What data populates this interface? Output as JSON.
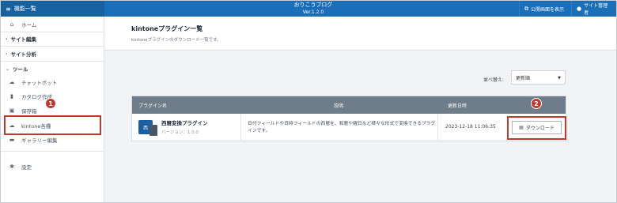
{
  "header": {
    "menu_label": "機能一覧",
    "brand": "おりこうブログ",
    "version": "Ver.1.2.0",
    "public_view_btn": "公開画面を表示",
    "site_admin_btn": "サイト管理者",
    "bg_color": "#1a6fb8"
  },
  "sidebar": {
    "home": "ホーム",
    "site_edit": "サイト編集",
    "site_analysis": "サイト分析",
    "tools": "ツール",
    "chatbot": "チャットボット",
    "catalog": "カタログ作成",
    "storage": "保存箱",
    "kintone": "kintone各種",
    "gallery": "ギャラリー編集",
    "settings": "設定"
  },
  "page": {
    "title": "kintoneプラグイン一覧",
    "subtitle": "kintoneプラグインのダウンロード一覧です。"
  },
  "sort": {
    "label": "並べ替え:",
    "value": "更新順"
  },
  "table": {
    "headers": [
      "プラグイン名",
      "説明",
      "更新日時"
    ],
    "rows": [
      {
        "name": "西暦変換プラグイン",
        "version": "バージョン：1.0.0",
        "description": "日付フィールドや日時フィールドの西暦を、和暦や曜日など様々な形式で変換できるプラグインです。",
        "updated": "2023-12-18 11:06:35",
        "download": "ダウンロード"
      }
    ]
  },
  "annotations": {
    "badge1": "1",
    "badge2": "2",
    "color": "#c0392b"
  }
}
